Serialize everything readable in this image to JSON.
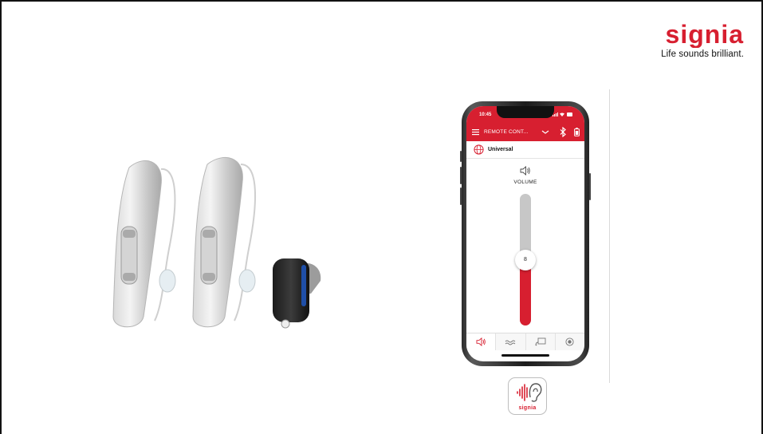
{
  "brand": {
    "tagline": "Life sounds brilliant.",
    "color": "#d71f30"
  },
  "phone_app": {
    "status_time": "10:45",
    "header_title": "REMOTE CONT...",
    "program_name": "Universal",
    "volume_label": "VOLUME",
    "volume_value": "8",
    "volume_level_fraction": 0.5,
    "accent_color": "#d71f30",
    "tabs": [
      {
        "icon": "speaker-icon",
        "active": true
      },
      {
        "icon": "wave-icon",
        "active": false
      },
      {
        "icon": "stream-icon",
        "active": false
      },
      {
        "icon": "record-icon",
        "active": false
      }
    ]
  },
  "app_icon": {
    "label": "signia"
  }
}
